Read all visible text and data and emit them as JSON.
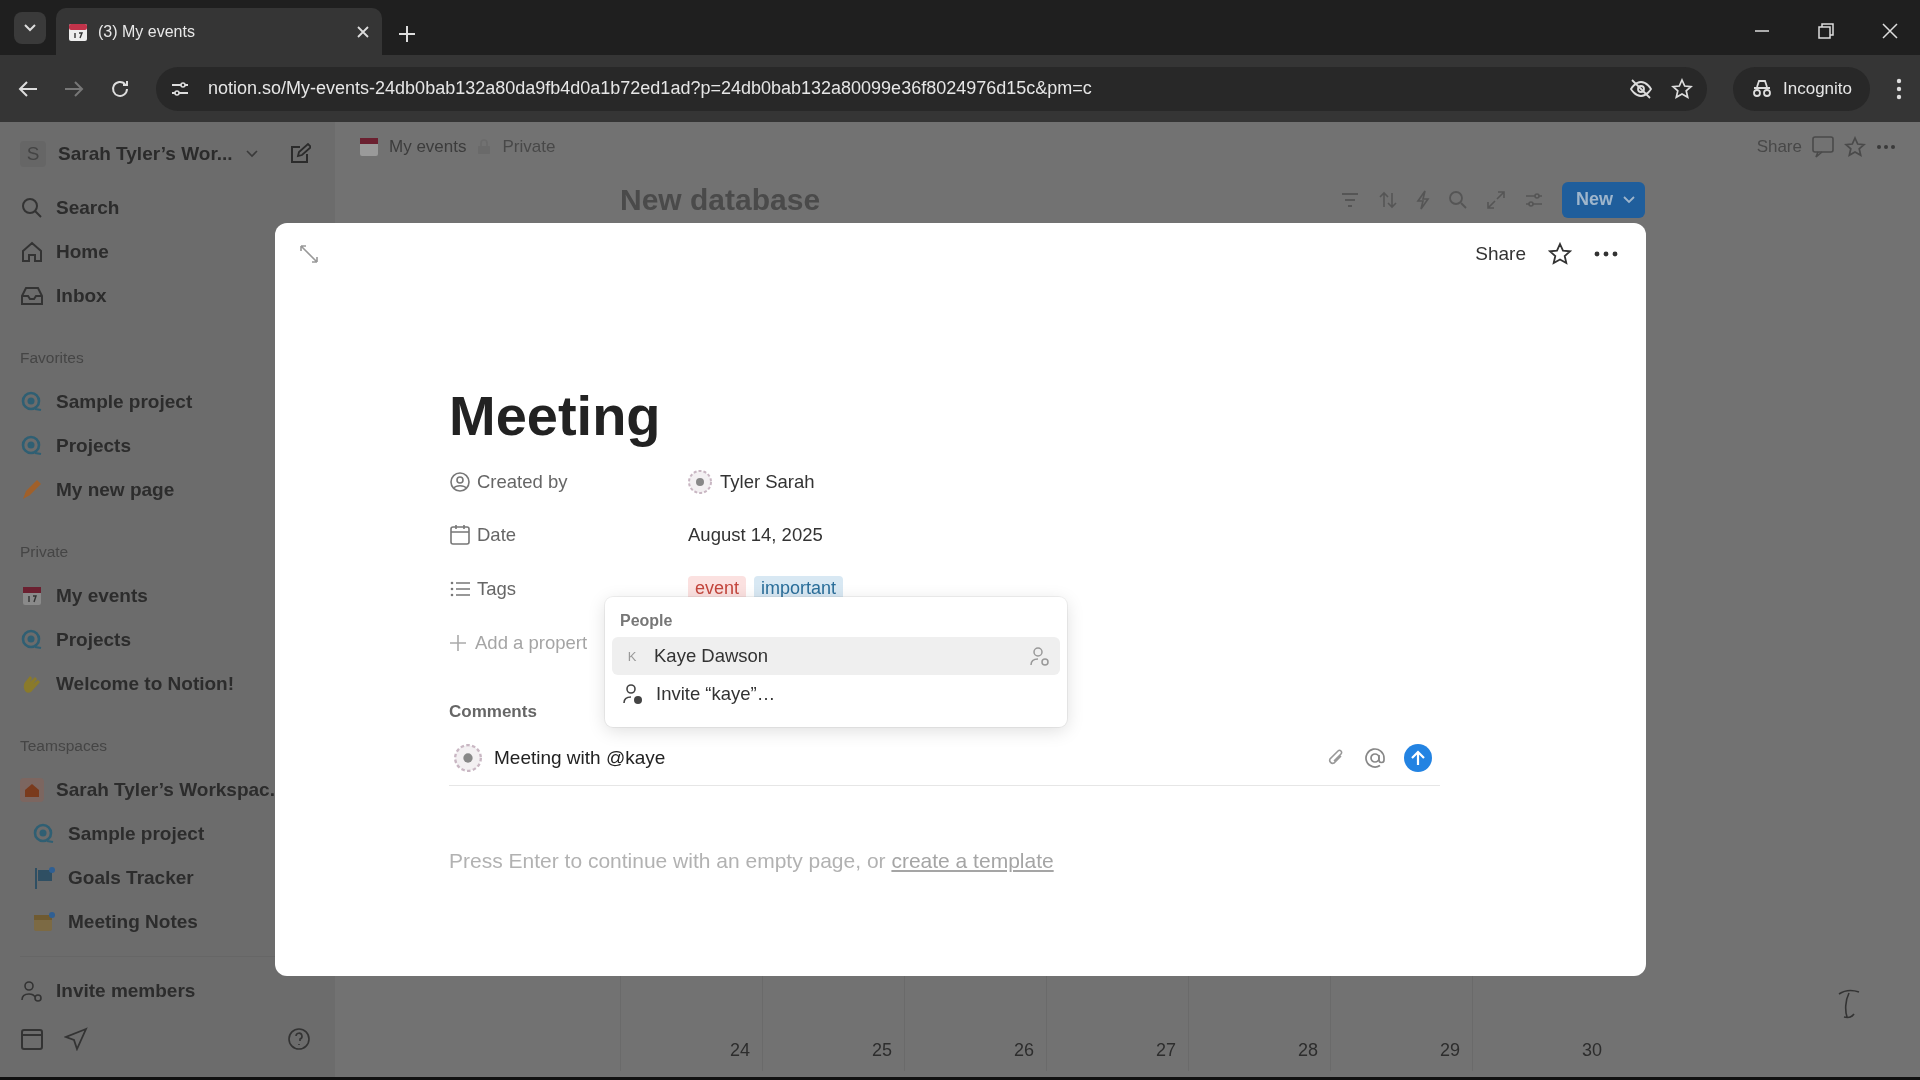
{
  "browser": {
    "tabs": [
      {
        "title": "(3) My events",
        "selected": true
      }
    ],
    "url": "notion.so/My-events-24db0bab132a80da9fb4d0a1b72ed1ad?p=24db0bab132a80099e36f8024976d15c&pm=c",
    "incognito": "Incognito"
  },
  "sidebar": {
    "workspace": {
      "initial": "S",
      "name": "Sarah Tyler’s Wor..."
    },
    "nav": [
      {
        "kind": "search",
        "label": "Search"
      },
      {
        "kind": "home",
        "label": "Home"
      },
      {
        "kind": "inbox",
        "label": "Inbox"
      }
    ],
    "sections": [
      {
        "title": "Favorites",
        "items": [
          {
            "kind": "database",
            "label": "Sample project"
          },
          {
            "kind": "database",
            "label": "Projects"
          },
          {
            "kind": "pencil",
            "label": "My new page"
          }
        ]
      },
      {
        "title": "Private",
        "items": [
          {
            "kind": "calendar",
            "label": "My events"
          },
          {
            "kind": "database",
            "label": "Projects"
          },
          {
            "kind": "welcome",
            "label": "Welcome to Notion!"
          }
        ]
      },
      {
        "title": "Teamspaces",
        "items": [
          {
            "kind": "workspace",
            "label": "Sarah Tyler’s Workspac.",
            "children": [
              {
                "kind": "database",
                "label": "Sample project"
              },
              {
                "kind": "goals",
                "label": "Goals Tracker"
              },
              {
                "kind": "notes",
                "label": "Meeting Notes"
              }
            ]
          }
        ]
      }
    ],
    "invite": "Invite members"
  },
  "page_header": {
    "breadcrumb": "My events",
    "privacy": "Private",
    "share": "Share"
  },
  "database": {
    "title": "New database",
    "new_button": "New",
    "calendar_days": [
      "24",
      "25",
      "26",
      "27",
      "28",
      "29",
      "30"
    ]
  },
  "modal": {
    "share": "Share",
    "title": "Meeting",
    "properties": [
      {
        "kind": "person",
        "label": "Created by",
        "value": "Tyler Sarah"
      },
      {
        "kind": "date",
        "label": "Date",
        "value": "August 14, 2025"
      },
      {
        "kind": "tags",
        "label": "Tags",
        "tags": [
          {
            "text": "event",
            "color": "#fbe1e0"
          },
          {
            "text": "important",
            "color": "#d8e8f3"
          }
        ]
      }
    ],
    "add_property": "Add a propert",
    "comments_label": "Comments",
    "comment_input": {
      "value": "Meeting with @kaye"
    },
    "hint": {
      "text": "Press Enter to continue with an empty page, or",
      "link": "create a template"
    }
  },
  "mention_menu": {
    "heading": "People",
    "items": [
      {
        "kind": "person",
        "initial": "K",
        "label": "Kaye Dawson",
        "selected": true
      },
      {
        "kind": "invite",
        "label": "Invite “kaye”…",
        "selected": false
      }
    ]
  }
}
